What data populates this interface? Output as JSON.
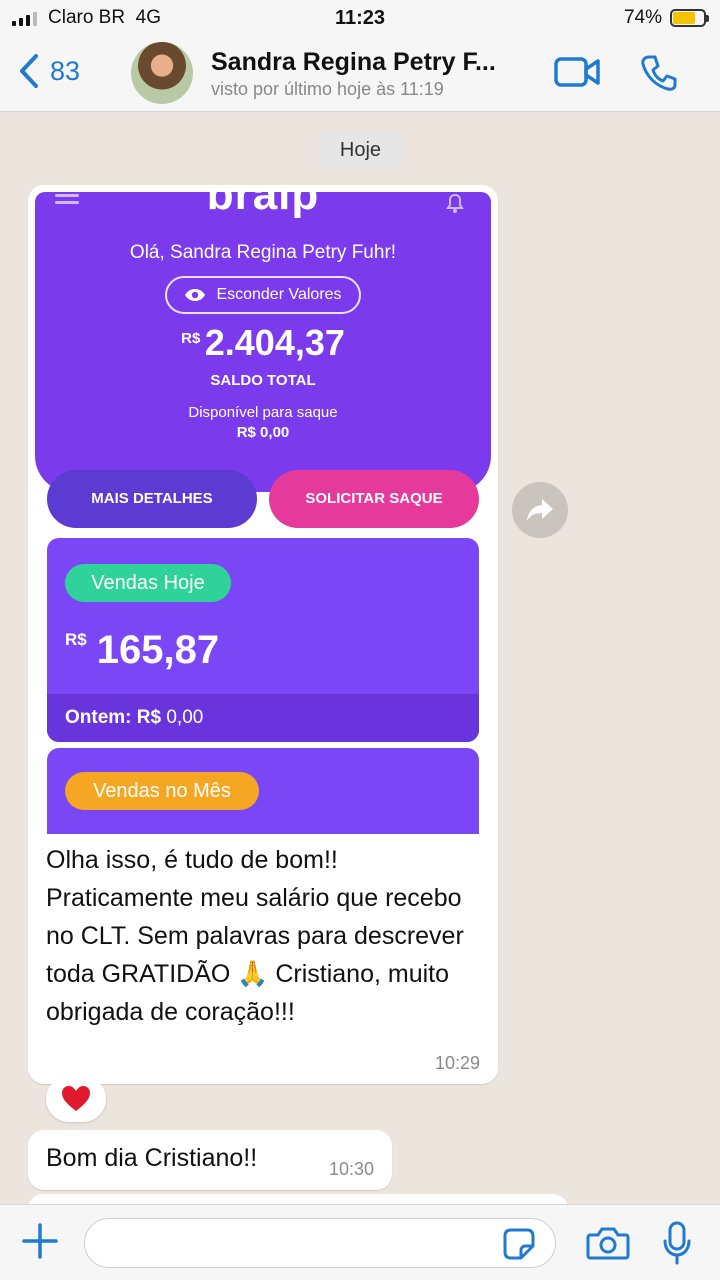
{
  "status_bar": {
    "carrier": "Claro BR",
    "network": "4G",
    "time": "11:23",
    "battery": "74%",
    "battery_level": 0.74
  },
  "header": {
    "back_count": "83",
    "contact_name": "Sandra Regina Petry F...",
    "last_seen": "visto por último hoje às 11:19"
  },
  "chat": {
    "date_label": "Hoje",
    "image": {
      "brand": "braip",
      "greeting": "Olá, Sandra Regina Petry Fuhr!",
      "hide_values": "Esconder Valores",
      "currency": "R$",
      "total_value": "2.404,37",
      "total_label": "SALDO TOTAL",
      "available_label": "Disponível para saque",
      "available_value": "R$ 0,00",
      "details_button": "MAIS DETALHES",
      "withdraw_button": "SOLICITAR SAQUE",
      "sales_today_label": "Vendas Hoje",
      "sales_today_value": "165,87",
      "yesterday_label": "Ontem: R$",
      "yesterday_value": "0,00",
      "sales_month_label": "Vendas no Mês"
    },
    "message1": {
      "text": "Olha isso, é tudo de bom!! Praticamente meu salário que recebo no CLT. Sem palavras para descrever toda GRATIDÃO 🙏 Cristiano, muito obrigada de coração!!!",
      "time": "10:29",
      "reaction": "❤️"
    },
    "message2": {
      "text": "Bom dia Cristiano!!",
      "time": "10:30"
    }
  },
  "input": {
    "placeholder": ""
  },
  "colors": {
    "ios_blue": "#1f7ad0",
    "braip_purple": "#7c3aed",
    "pink": "#e5399b",
    "green_badge": "#2fd39a",
    "orange_badge": "#f5a623",
    "chat_bg": "#ece5dd"
  }
}
